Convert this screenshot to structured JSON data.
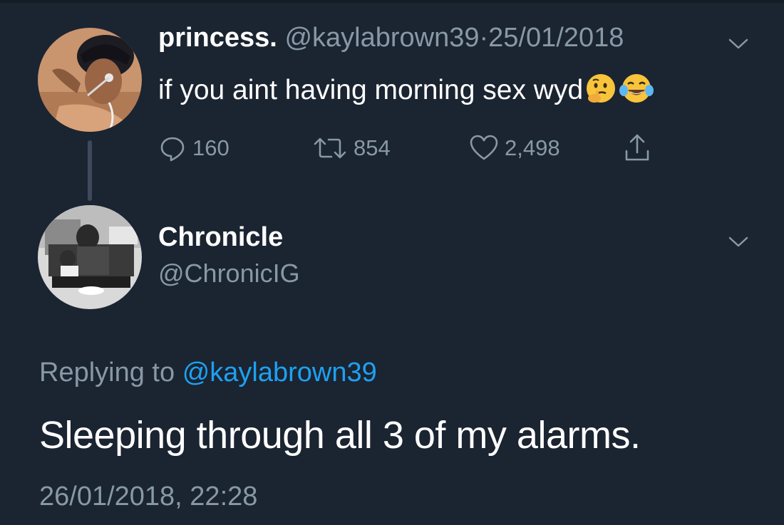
{
  "original_tweet": {
    "display_name": "princess.",
    "handle": "@kaylabrown39",
    "separator": "·",
    "date": "25/01/2018",
    "text": "if you aint having morning sex wyd",
    "emojis": [
      "thinking-face",
      "face-with-tears-of-joy"
    ],
    "actions": {
      "replies": "160",
      "retweets": "854",
      "likes": "2,498"
    }
  },
  "reply_tweet": {
    "display_name": "Chronicle",
    "handle": "@ChronicIG",
    "replying_prefix": "Replying to",
    "replying_mention": "@kaylabrown39",
    "text": "Sleeping through all 3 of my alarms.",
    "timestamp": "26/01/2018, 22:28"
  },
  "icons": [
    "chevron-down-icon",
    "reply-icon",
    "retweet-icon",
    "heart-icon",
    "share-icon"
  ],
  "colors": {
    "background": "#1b2431",
    "text": "#ffffff",
    "secondary_text": "#8899a6",
    "mention": "#1da1f2"
  }
}
